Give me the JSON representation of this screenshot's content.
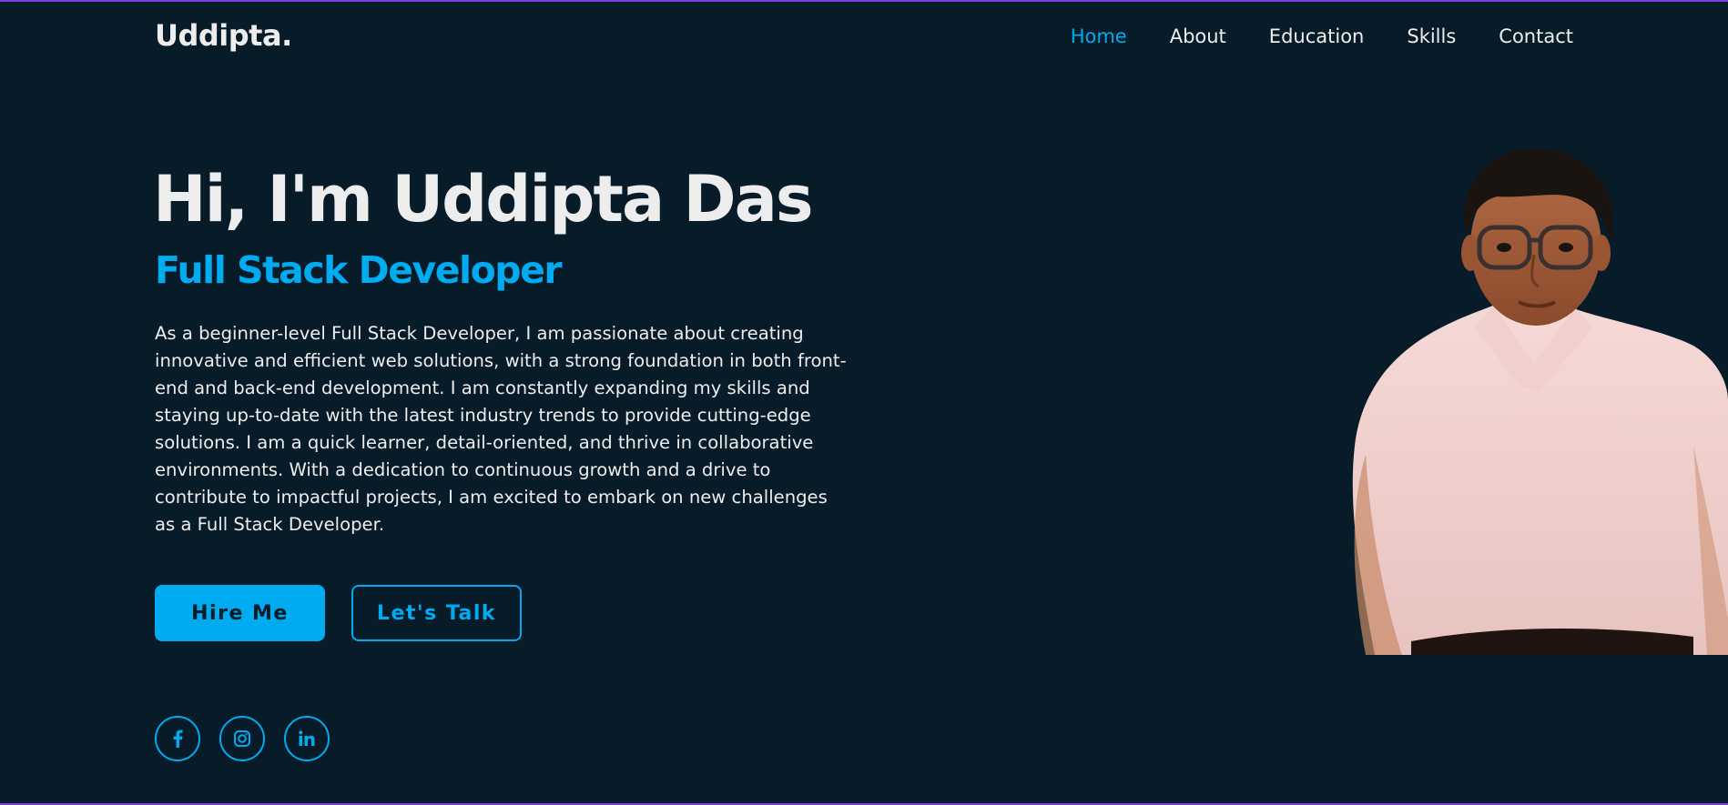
{
  "brand": {
    "logo": "Uddipta."
  },
  "nav": {
    "items": [
      {
        "label": "Home",
        "active": true
      },
      {
        "label": "About",
        "active": false
      },
      {
        "label": "Education",
        "active": false
      },
      {
        "label": "Skills",
        "active": false
      },
      {
        "label": "Contact",
        "active": false
      }
    ]
  },
  "hero": {
    "title": "Hi, I'm Uddipta Das",
    "subtitle": "Full Stack Developer",
    "description": "As a beginner-level Full Stack Developer, I am passionate about creating innovative and efficient web solutions, with a strong foundation in both front-end and back-end development. I am constantly expanding my skills and staying up-to-date with the latest industry trends to provide cutting-edge solutions. I am a quick learner, detail-oriented, and thrive in collaborative environments. With a dedication to continuous growth and a drive to contribute to impactful projects, I am excited to embark on new challenges as a Full Stack Developer.",
    "primary_button": "Hire Me",
    "secondary_button": "Let's Talk"
  },
  "social": {
    "icons": [
      "facebook-icon",
      "instagram-icon",
      "linkedin-icon"
    ]
  },
  "colors": {
    "background": "#081b29",
    "accent": "#00abf0",
    "text": "#ededed",
    "border_top": "#7b3fe4"
  }
}
